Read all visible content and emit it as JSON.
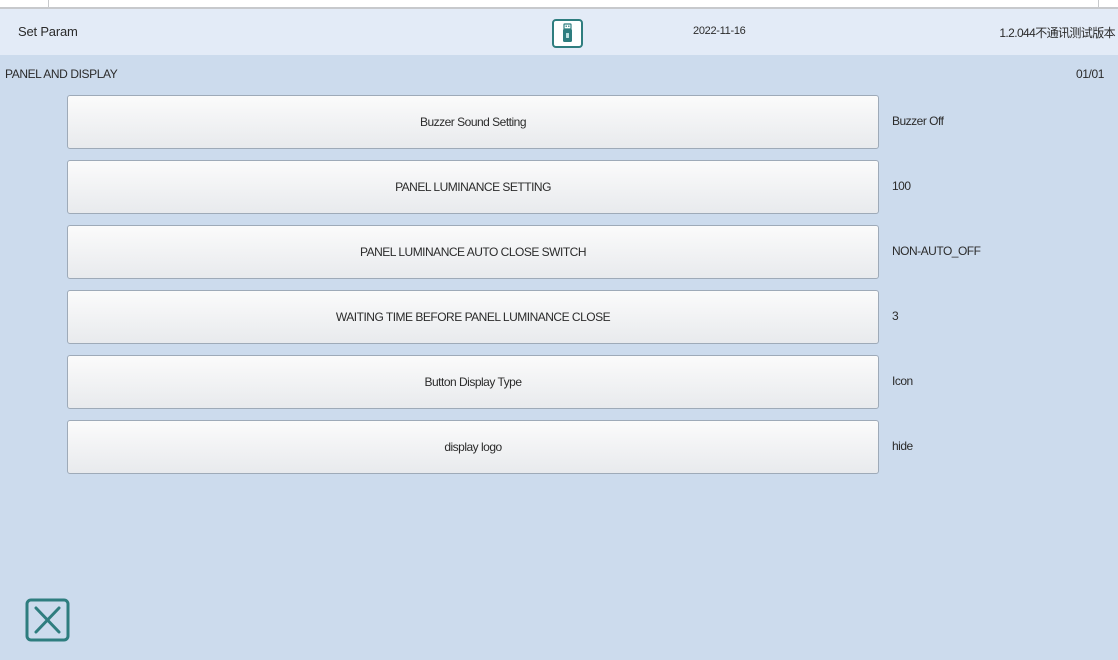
{
  "header": {
    "title": "Set Param",
    "date": "2022-11-16",
    "version": "1.2.044不通讯测试版本"
  },
  "panel": {
    "section_title": "PANEL AND DISPLAY",
    "page_indicator": "01/01"
  },
  "settings": [
    {
      "label": "Buzzer Sound Setting",
      "value": "Buzzer Off"
    },
    {
      "label": "PANEL LUMINANCE SETTING",
      "value": "100"
    },
    {
      "label": "PANEL LUMINANCE AUTO CLOSE SWITCH",
      "value": "NON-AUTO_OFF"
    },
    {
      "label": "WAITING TIME BEFORE PANEL LUMINANCE CLOSE",
      "value": "3"
    },
    {
      "label": "Button Display Type",
      "value": "Icon"
    },
    {
      "label": "display logo",
      "value": "hide"
    }
  ],
  "icons": {
    "usb": "usb-drive-icon",
    "close": "close-icon"
  },
  "colors": {
    "header_bg": "#e3ebf7",
    "content_bg": "#ccdbed",
    "accent": "#2e7d7f"
  }
}
